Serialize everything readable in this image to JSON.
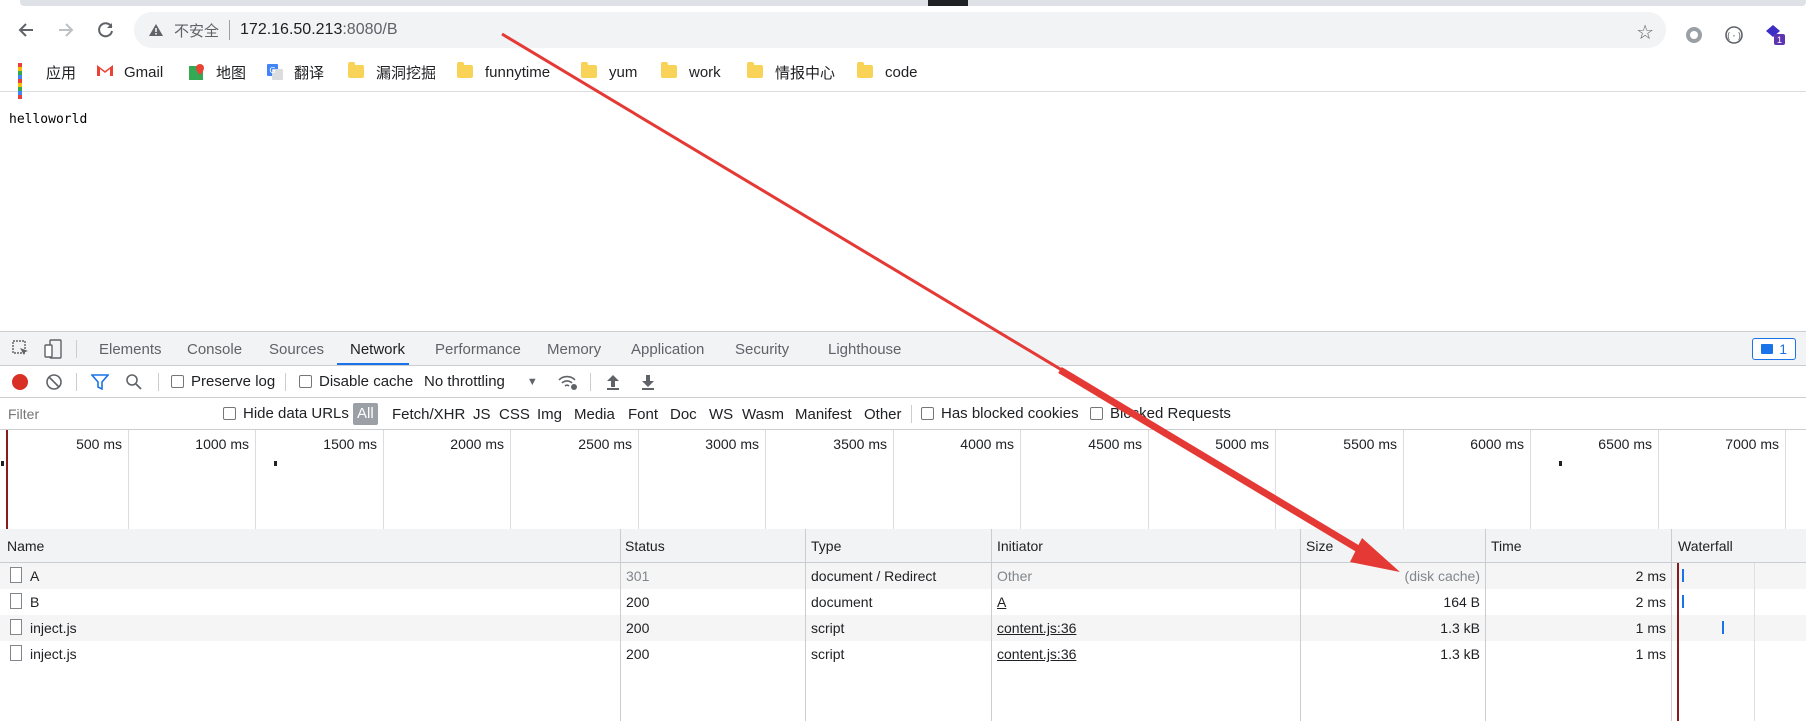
{
  "browser": {
    "url_security": "不安全",
    "url_host": "172.16.50.213",
    "url_rest": ":8080/B",
    "bookmarks": [
      {
        "label": "应用",
        "icon": "apps-grid-icon"
      },
      {
        "label": "Gmail",
        "icon": "gmail-icon"
      },
      {
        "label": "地图",
        "icon": "maps-icon"
      },
      {
        "label": "翻译",
        "icon": "translate-icon"
      },
      {
        "label": "漏洞挖掘",
        "icon": "folder-icon"
      },
      {
        "label": "funnytime",
        "icon": "folder-icon"
      },
      {
        "label": "yum",
        "icon": "folder-icon"
      },
      {
        "label": "work",
        "icon": "folder-icon"
      },
      {
        "label": "情报中心",
        "icon": "folder-icon"
      },
      {
        "label": "code",
        "icon": "folder-icon"
      }
    ],
    "extension_badge": "1"
  },
  "page": {
    "text": "helloworld"
  },
  "devtools": {
    "tabs": [
      "Elements",
      "Console",
      "Sources",
      "Network",
      "Performance",
      "Memory",
      "Application",
      "Security",
      "Lighthouse"
    ],
    "active_tab": "Network",
    "messages_count": "1",
    "toolbar": {
      "preserve_log": "Preserve log",
      "disable_cache": "Disable cache",
      "throttling": "No throttling"
    },
    "filter": {
      "placeholder": "Filter",
      "hide_data_urls": "Hide data URLs",
      "types": [
        "All",
        "Fetch/XHR",
        "JS",
        "CSS",
        "Img",
        "Media",
        "Font",
        "Doc",
        "WS",
        "Wasm",
        "Manifest",
        "Other"
      ],
      "has_blocked_cookies": "Has blocked cookies",
      "blocked_requests": "Blocked Requests"
    },
    "overview_ticks": [
      "500 ms",
      "1000 ms",
      "1500 ms",
      "2000 ms",
      "2500 ms",
      "3000 ms",
      "3500 ms",
      "4000 ms",
      "4500 ms",
      "5000 ms",
      "5500 ms",
      "6000 ms",
      "6500 ms",
      "7000 ms"
    ],
    "columns": [
      "Name",
      "Status",
      "Type",
      "Initiator",
      "Size",
      "Time",
      "Waterfall"
    ],
    "requests": [
      {
        "name": "A",
        "status": "301",
        "type": "document / Redirect",
        "initiator": "Other",
        "size": "(disk cache)",
        "time": "2 ms"
      },
      {
        "name": "B",
        "status": "200",
        "type": "document",
        "initiator": "A",
        "size": "164 B",
        "time": "2 ms"
      },
      {
        "name": "inject.js",
        "status": "200",
        "type": "script",
        "initiator": "content.js:36",
        "size": "1.3 kB",
        "time": "1 ms"
      },
      {
        "name": "inject.js",
        "status": "200",
        "type": "script",
        "initiator": "content.js:36",
        "size": "1.3 kB",
        "time": "1 ms"
      }
    ]
  },
  "colors": {
    "accent": "#1a73e8",
    "record": "#d93025",
    "annotation_arrow": "#e53935"
  }
}
